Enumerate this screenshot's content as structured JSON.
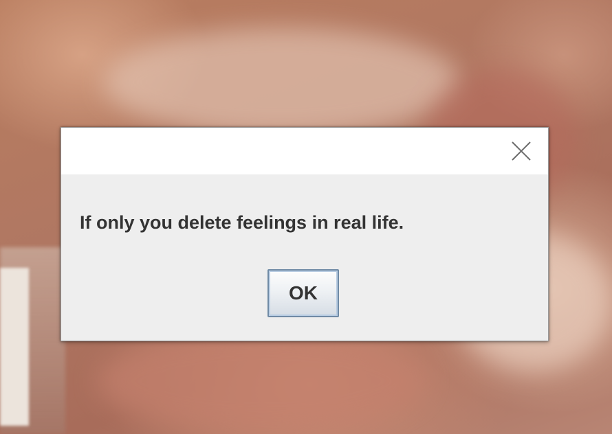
{
  "dialog": {
    "message": "If only you delete feelings in real life.",
    "ok_label": "OK",
    "close_icon": "close-icon"
  },
  "colors": {
    "dialog_body": "#eeeeee",
    "titlebar": "#ffffff",
    "text": "#333333",
    "button_border": "#6f8aa5"
  }
}
